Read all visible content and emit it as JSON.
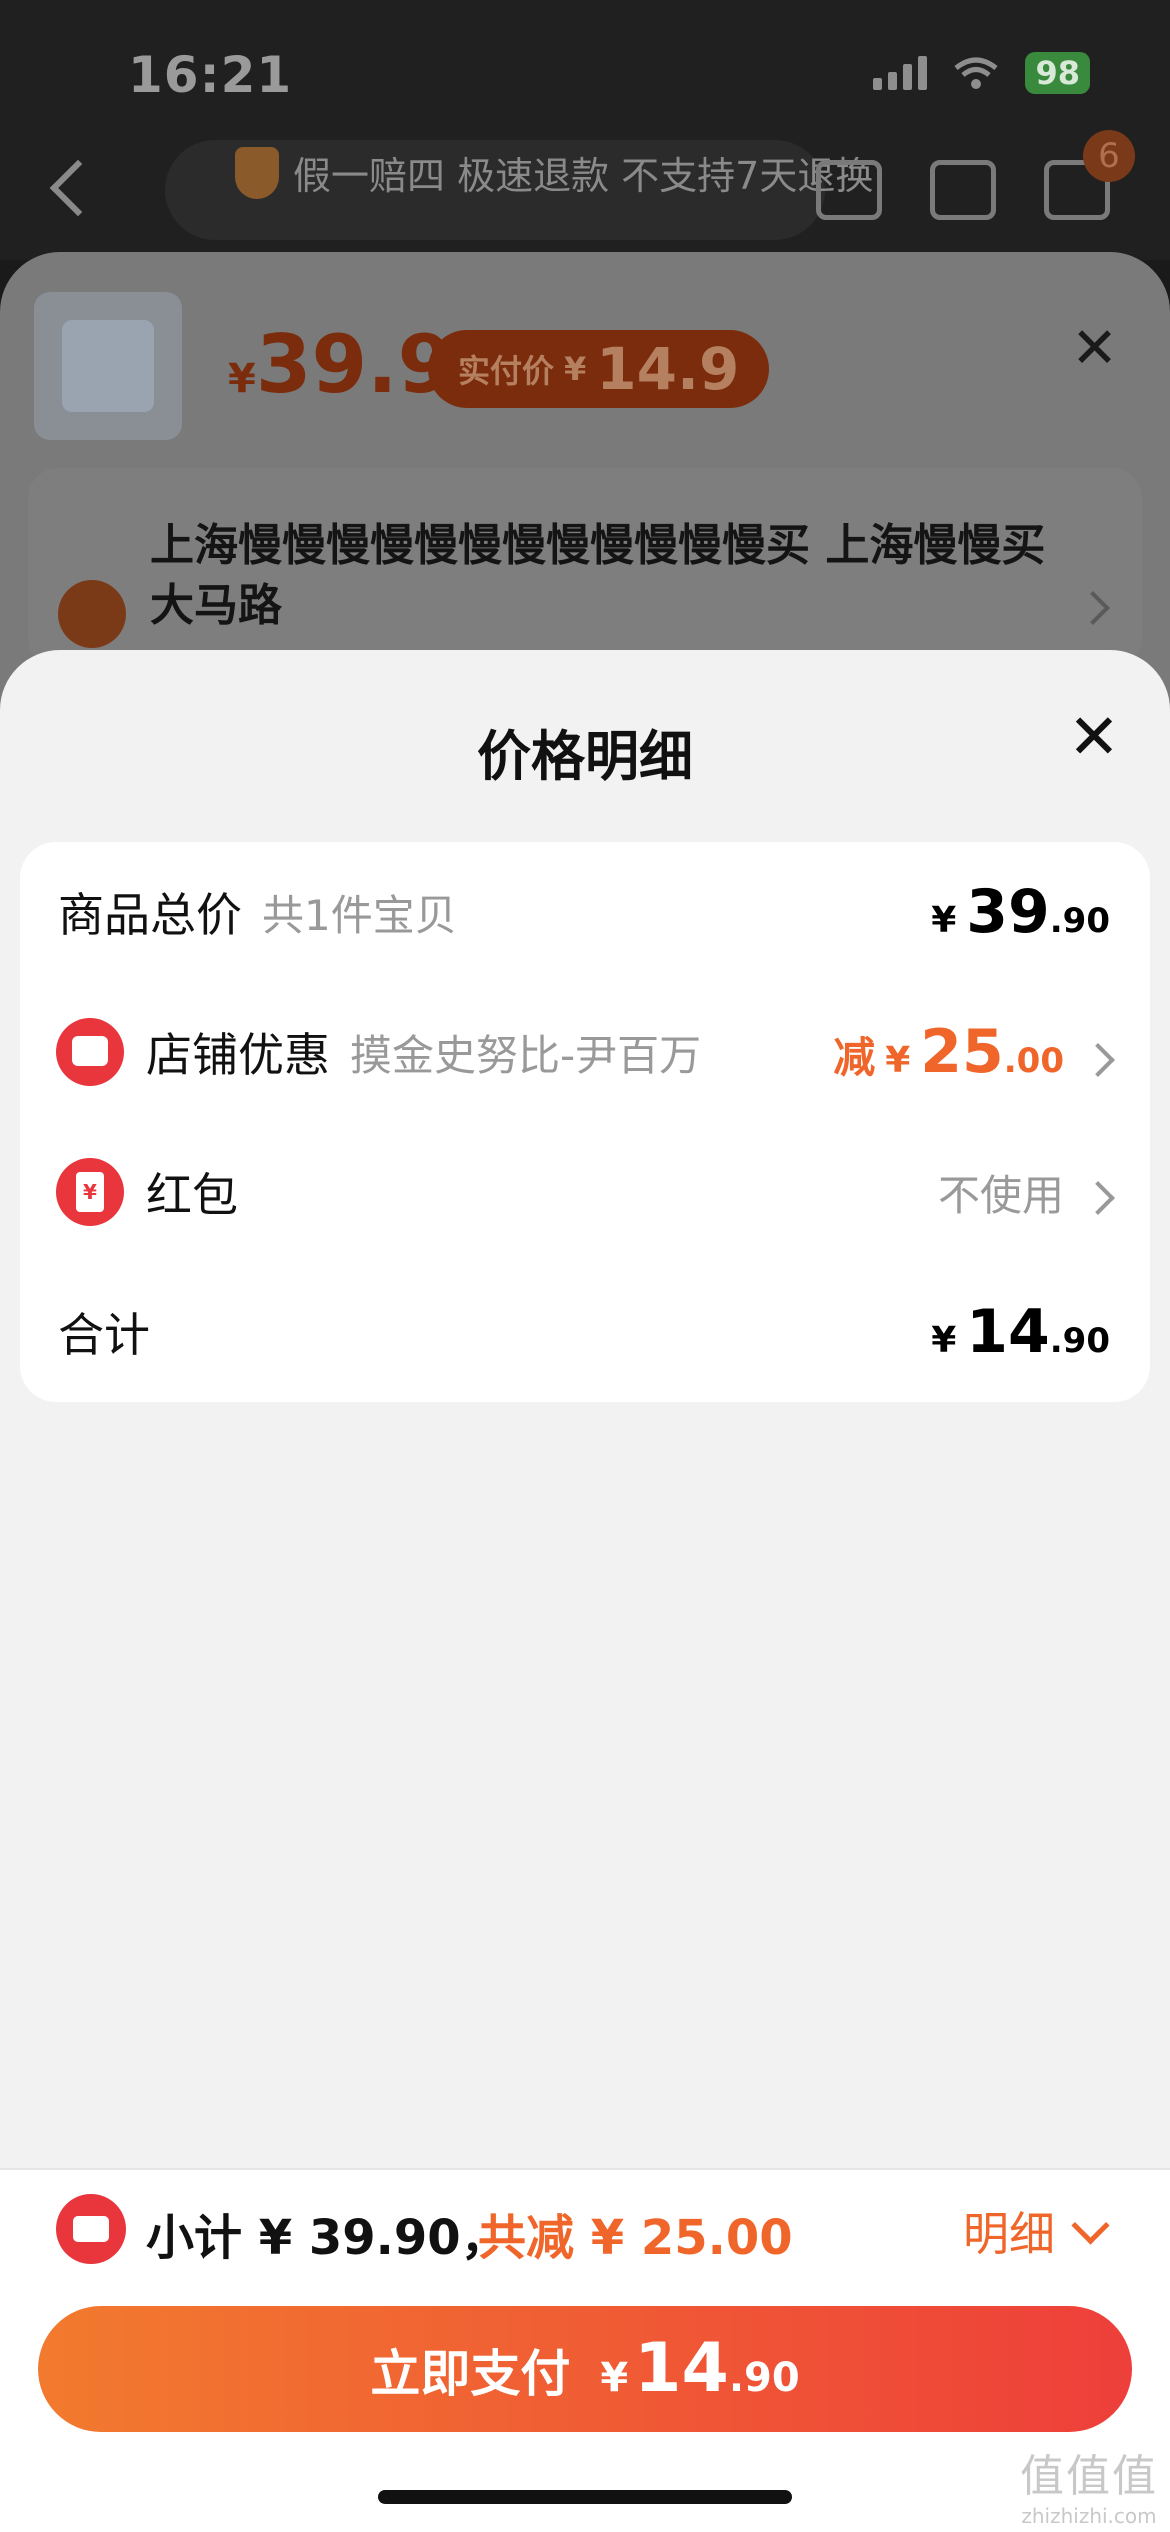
{
  "status_bar": {
    "time": "16:21",
    "battery": "98"
  },
  "background": {
    "guarantee_text": "假一赔四 极速退款 不支持7天退换",
    "cart_badge": "6",
    "product": {
      "currency": "¥",
      "price": "39.9",
      "paid_label": "实付价",
      "paid_currency": "¥",
      "paid_price": "14.9"
    },
    "address": "上海慢慢慢慢慢慢慢慢慢慢慢慢买 上海慢慢买大马路"
  },
  "sheet": {
    "title": "价格明细",
    "rows": {
      "total": {
        "label": "商品总价",
        "sub": "共1件宝贝",
        "currency": "¥",
        "int": "39",
        "dec": ".90"
      },
      "shop": {
        "label": "店铺优惠",
        "sub": "摸金史努比-尹百万",
        "prefix": "减",
        "currency": "¥",
        "int": "25",
        "dec": ".00"
      },
      "redpack": {
        "label": "红包",
        "icon_text": "¥",
        "value": "不使用"
      },
      "sum": {
        "label": "合计",
        "currency": "¥",
        "int": "14",
        "dec": ".90"
      }
    }
  },
  "bottom_bar": {
    "subtotal": "小计 ¥ 39.90，",
    "reduced": "共减 ¥ 25.00",
    "detail_label": "明细",
    "pay_button": {
      "label": "立即支付",
      "currency": "¥",
      "int": "14",
      "dec": ".90"
    }
  },
  "watermark": {
    "logo": "值值值",
    "url": "zhizhizhi.com"
  },
  "colors": {
    "accent": "#f0652a",
    "red": "#e8363c",
    "gradient_start": "#f27a2e",
    "gradient_end": "#ee3f3a"
  }
}
